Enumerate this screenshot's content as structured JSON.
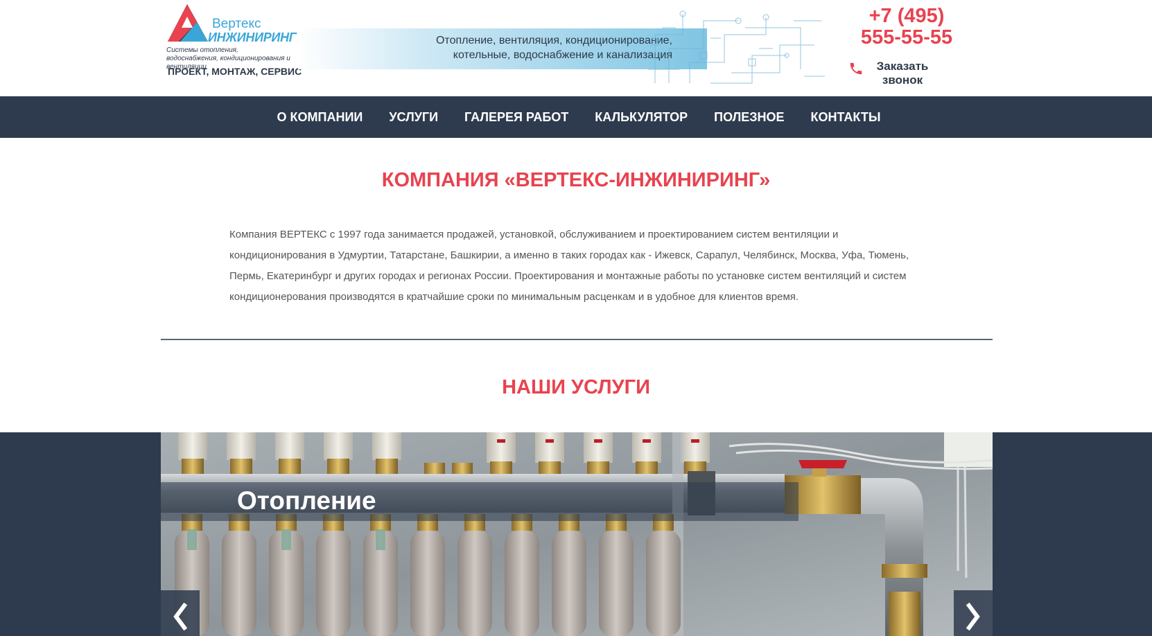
{
  "header": {
    "logo": {
      "word1": "Вертекс",
      "word2": "ИНЖИНИРИНГ",
      "subtitle": "Системы отопления, водоснабжения, кондиционирования и вентиляции",
      "tagline": "ПРОЕКТ, МОНТАЖ, СЕРВИС"
    },
    "banner_line1": "Отопление, вентиляция, кондиционирование,",
    "banner_line2": "котельные, водоснабжение и канализация",
    "phone_line1": "+7 (495)",
    "phone_line2": "555-55-55",
    "call_line1": "Заказать",
    "call_line2": "звонок",
    "icons": {
      "phone": "phone-icon"
    }
  },
  "nav": {
    "items": [
      {
        "label": "О КОМПАНИИ"
      },
      {
        "label": "УСЛУГИ"
      },
      {
        "label": "ГАЛЕРЕЯ РАБОТ"
      },
      {
        "label": "КАЛЬКУЛЯТОР"
      },
      {
        "label": "ПОЛЕЗНОЕ"
      },
      {
        "label": "КОНТАКТЫ"
      }
    ]
  },
  "main": {
    "company_heading": "КОМПАНИЯ «ВЕРТЕКС-ИНЖИНИРИНГ»",
    "about_text": "Компания ВЕРТЕКС с 1997 года занимается продажей, установкой, обслуживанием и проектированием систем вентиляции и кондиционирования в Удмуртии, Татарстане, Башкирии, а именно в таких городах как - Ижевск, Сарапул, Челябинск, Москва, Уфа, Тюмень, Пермь, Екатеринбург и других городах и регионах России. Проектирования и монтажные работы по установке систем вентиляций и систем кондиционерования производятся в кратчайшие сроки по минимальным расценкам и в удобное для клиентов время.",
    "services_heading": "НАШИ УСЛУГИ"
  },
  "slider": {
    "caption": "Отопление",
    "icons": {
      "prev": "chevron-left-icon",
      "next": "chevron-right-icon"
    }
  },
  "colors": {
    "accent": "#e8434f",
    "nav_bg": "#2e3b4e",
    "logo_blue": "#3aa6d8",
    "text_dark": "#2d3a4a"
  }
}
